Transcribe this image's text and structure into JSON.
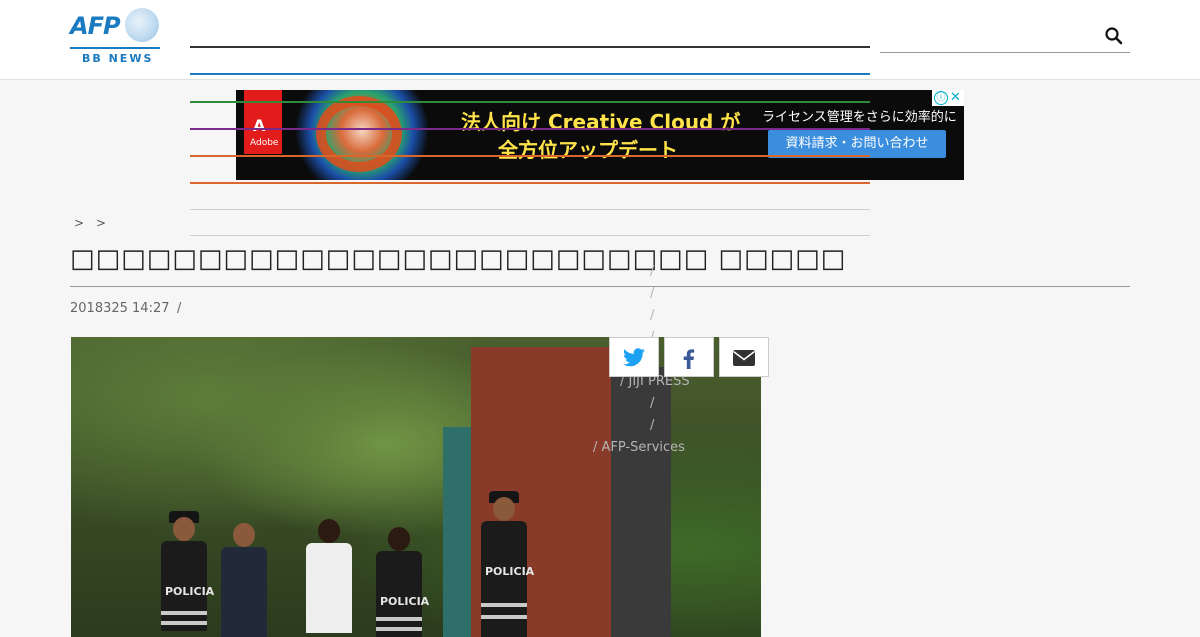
{
  "header": {
    "logo": {
      "brand": "AFP",
      "sub": "BB NEWS"
    },
    "nav_line_colors": [
      "#333333",
      "#1a7bc1",
      "#2f8a3a",
      "#7a2a8a",
      "#d9662b",
      "#d9662b",
      "#cccccc",
      "#cccccc"
    ],
    "search": {
      "placeholder": "",
      "icon": "search-icon"
    }
  },
  "ad": {
    "brand": "Adobe",
    "headline_line1": "法人向け Creative Cloud が",
    "headline_line2": "全方位アップデート",
    "subtext": "ライセンス管理をさらに効率的に",
    "cta": "資料請求・お問い合わせ",
    "adchoices": "ⓘ",
    "close": "✕"
  },
  "article": {
    "breadcrumb": "> >",
    "title": "□□□□□□□□□□□□□□□□□□□□□□□□□ □□□□□",
    "date": "2018325 14:27",
    "date_separator": "/",
    "credits": [
      {
        "text": "/"
      },
      {
        "text": "/"
      },
      {
        "text": "/"
      },
      {
        "text": "/"
      },
      {
        "text": "/"
      },
      {
        "text": "/ JIJI PRESS"
      },
      {
        "text": "/"
      },
      {
        "text": "/"
      },
      {
        "text": "/  AFP-Services"
      }
    ],
    "photo_vest_label": "POLICIA"
  },
  "share": [
    {
      "name": "twitter",
      "color": "#1da1f2"
    },
    {
      "name": "facebook",
      "color": "#3b5998"
    },
    {
      "name": "email",
      "color": "#333333"
    }
  ]
}
